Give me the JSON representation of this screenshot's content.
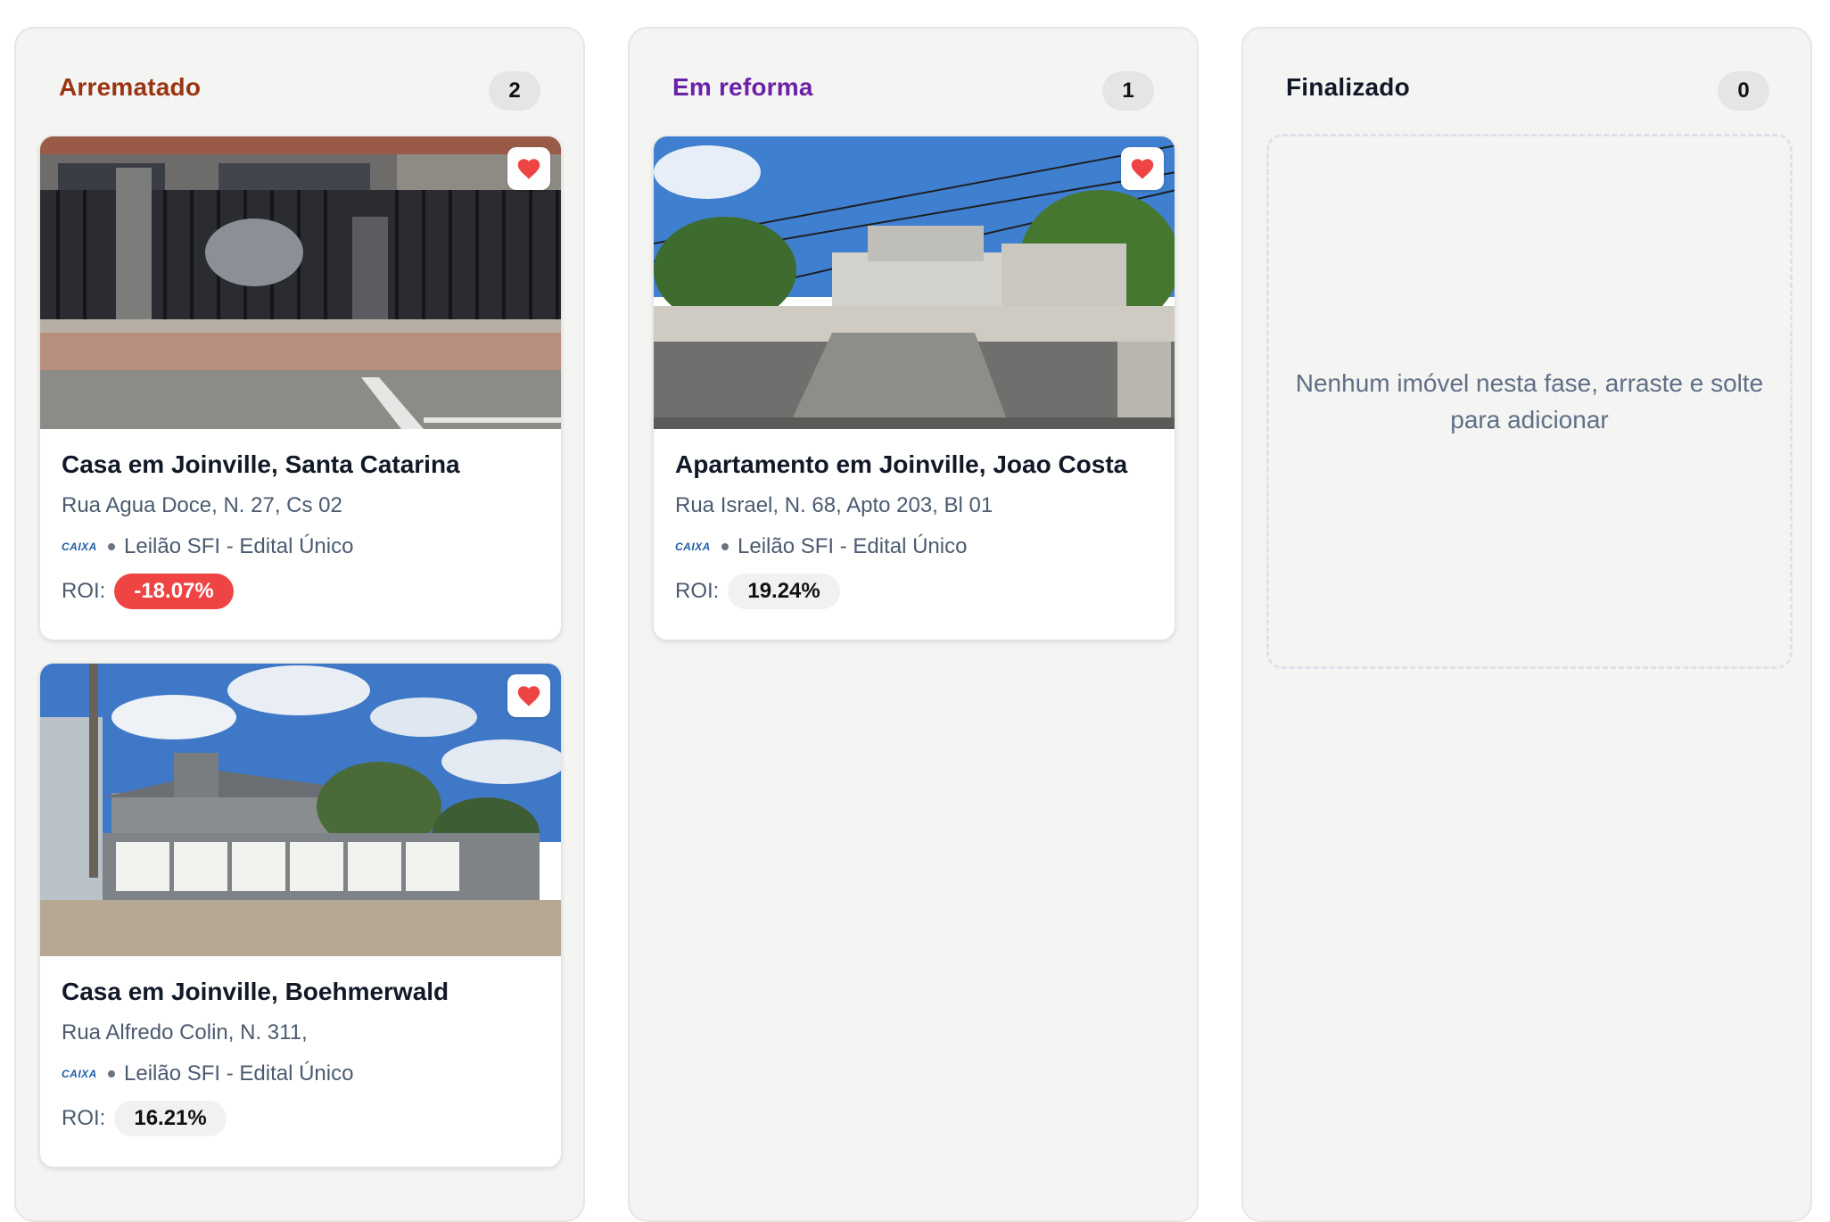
{
  "columns": [
    {
      "title": "Arrematado",
      "title_color": "#9a3412",
      "count": "2",
      "cards": [
        {
          "title": "Casa em Joinville, Santa Catarina",
          "address": "Rua Agua Doce, N. 27, Cs 02",
          "bank_logo": "CAIXA",
          "auction": "Leilão SFI - Edital Único",
          "roi_label": "ROI:",
          "roi_value": "-18.07%",
          "roi_negative": true,
          "favorited": true
        },
        {
          "title": "Casa em Joinville, Boehmerwald",
          "address": "Rua Alfredo Colin, N. 311,",
          "bank_logo": "CAIXA",
          "auction": "Leilão SFI - Edital Único",
          "roi_label": "ROI:",
          "roi_value": "16.21%",
          "roi_negative": false,
          "favorited": true
        }
      ]
    },
    {
      "title": "Em reforma",
      "title_color": "#6b21a8",
      "count": "1",
      "cards": [
        {
          "title": "Apartamento em Joinville, Joao Costa",
          "address": "Rua Israel, N. 68, Apto 203, Bl 01",
          "bank_logo": "CAIXA",
          "auction": "Leilão SFI - Edital Único",
          "roi_label": "ROI:",
          "roi_value": "19.24%",
          "roi_negative": false,
          "favorited": true
        }
      ]
    },
    {
      "title": "Finalizado",
      "title_color": "#111827",
      "count": "0",
      "empty_message": "Nenhum imóvel nesta fase, arraste e solte para adicionar",
      "cards": []
    }
  ],
  "icons": {
    "favorite": "heart-icon",
    "favorite_color": "#ef4444"
  }
}
